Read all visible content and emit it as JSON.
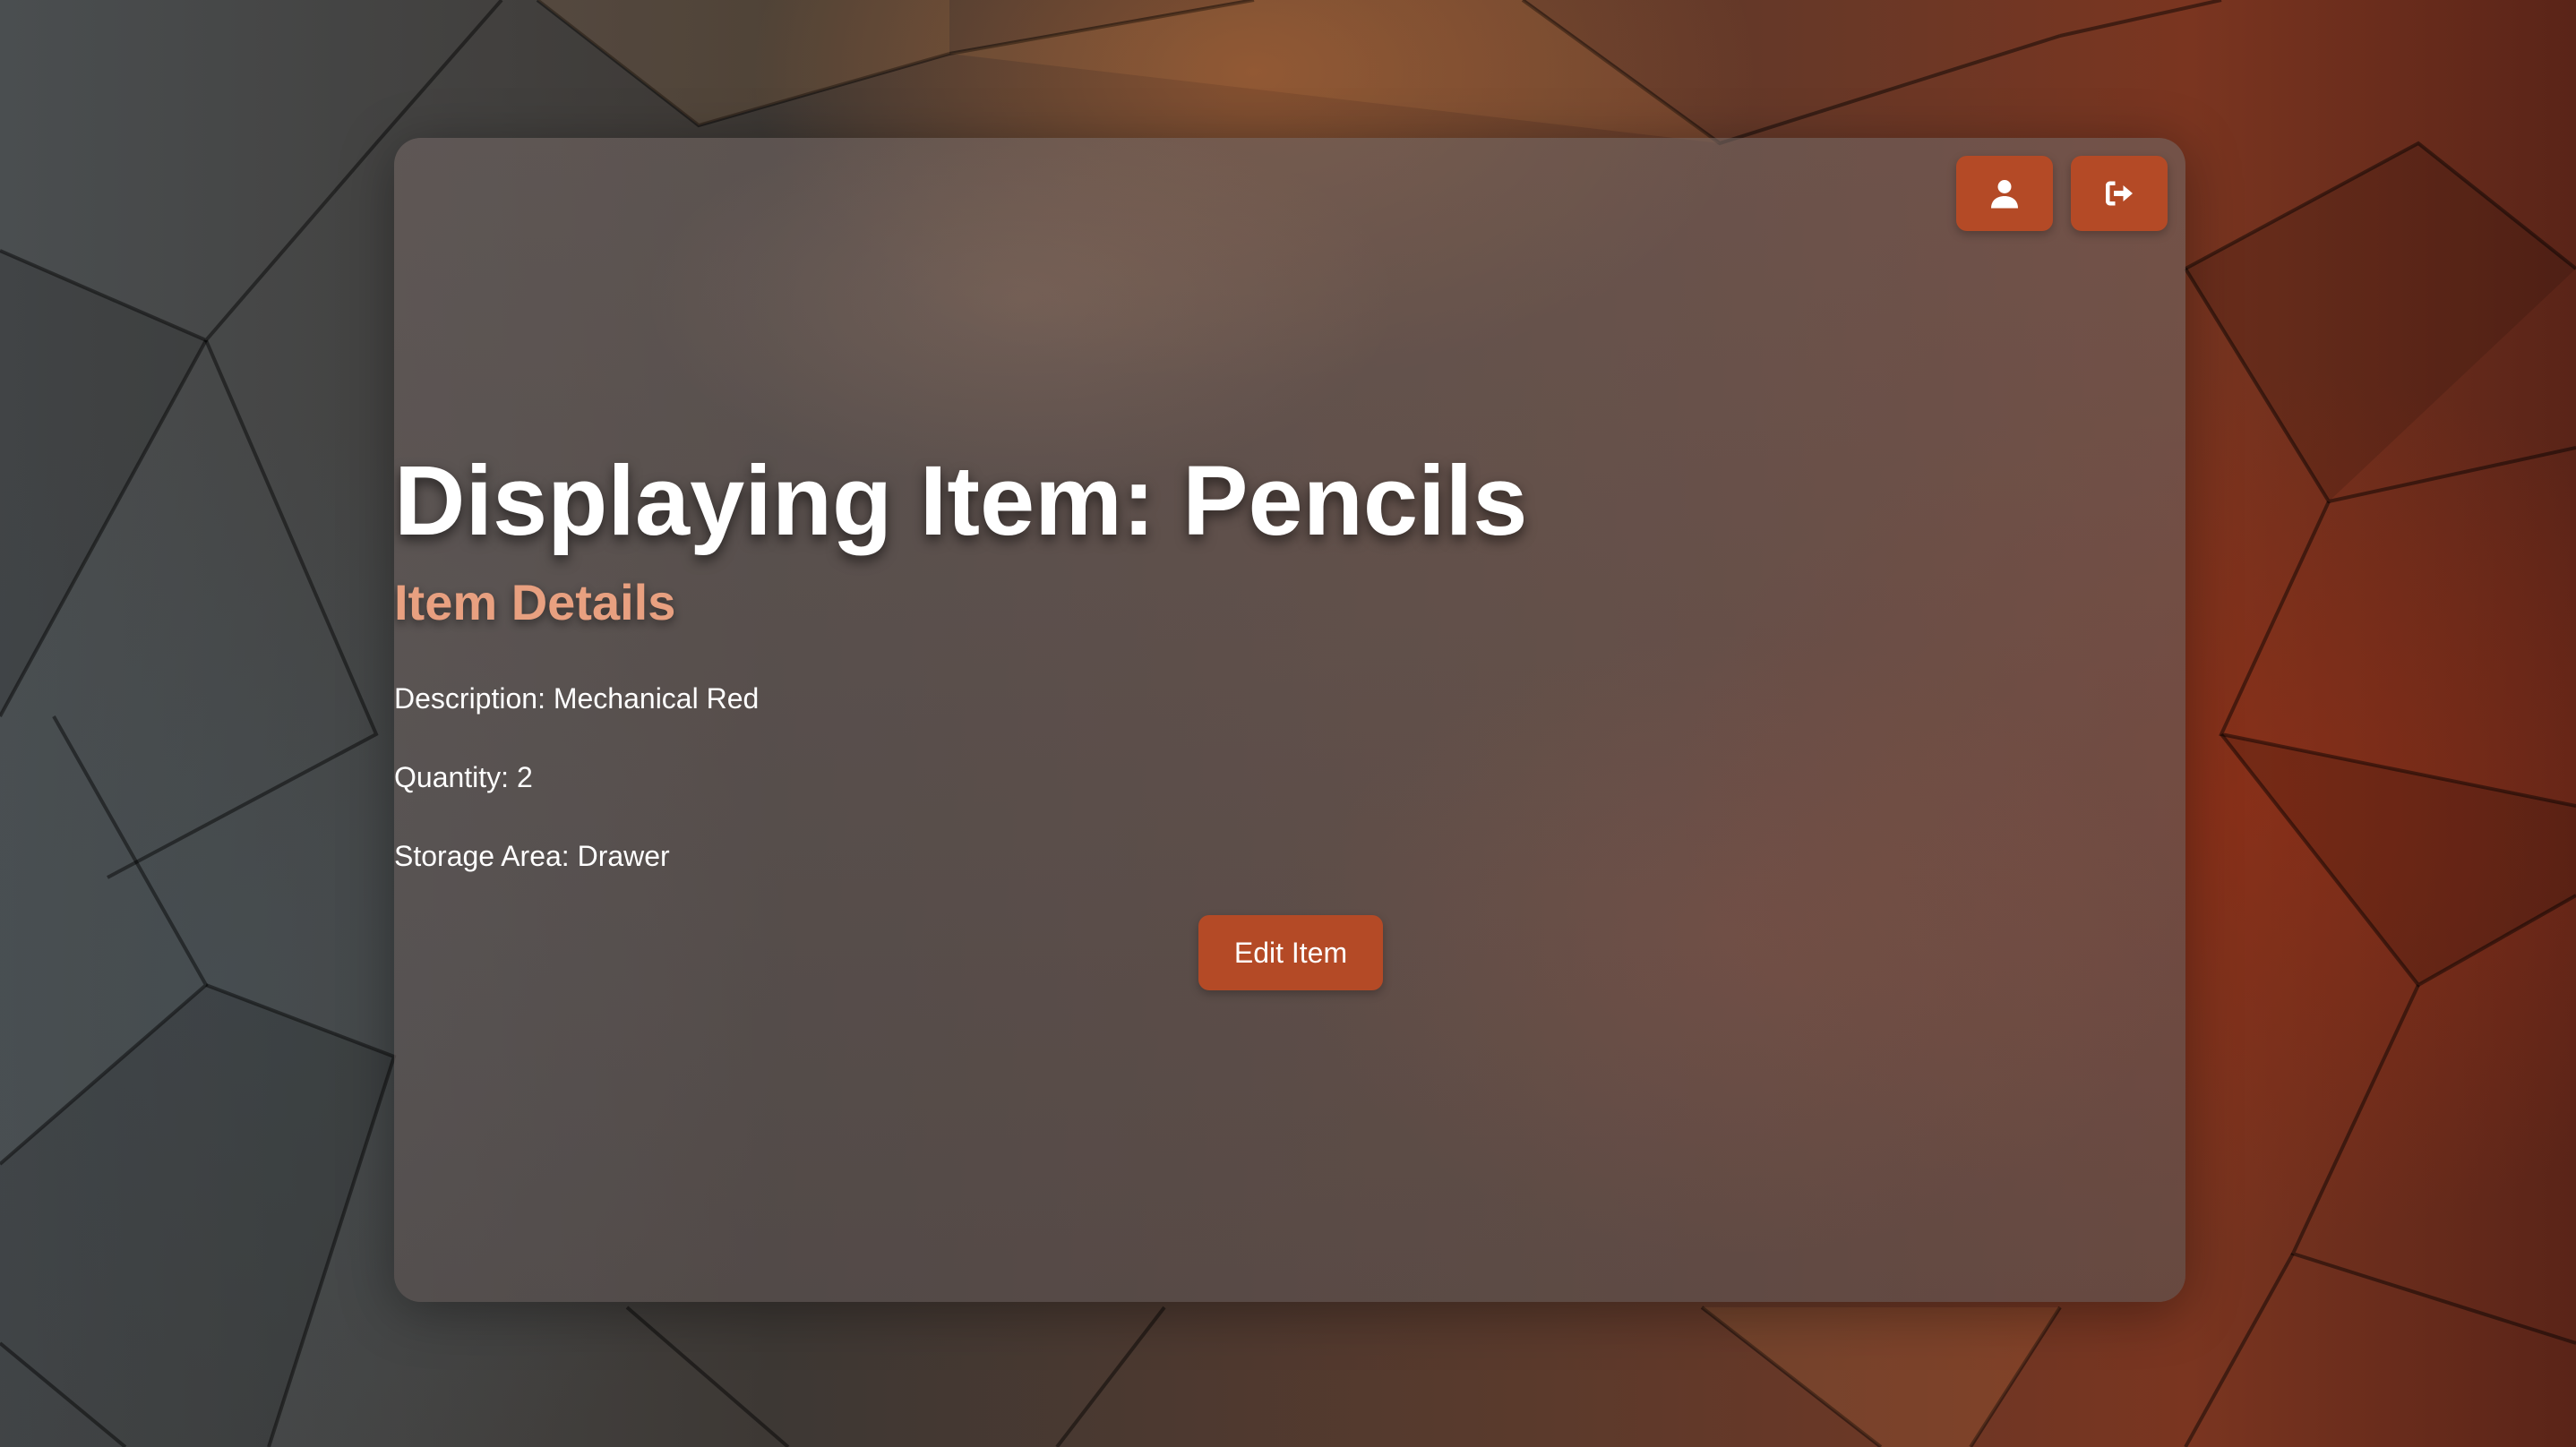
{
  "header": {
    "profile_icon": "user-icon",
    "logout_icon": "sign-out-icon"
  },
  "main": {
    "title": "Displaying Item: Pencils",
    "subtitle": "Item Details",
    "description": "Description: Mechanical Red",
    "quantity": "Quantity: 2",
    "storage_area": "Storage Area: Drawer",
    "edit_button_label": "Edit Item"
  },
  "colors": {
    "accent": "#b44a26",
    "subtitle": "#e8a080",
    "text": "#ffffff"
  }
}
